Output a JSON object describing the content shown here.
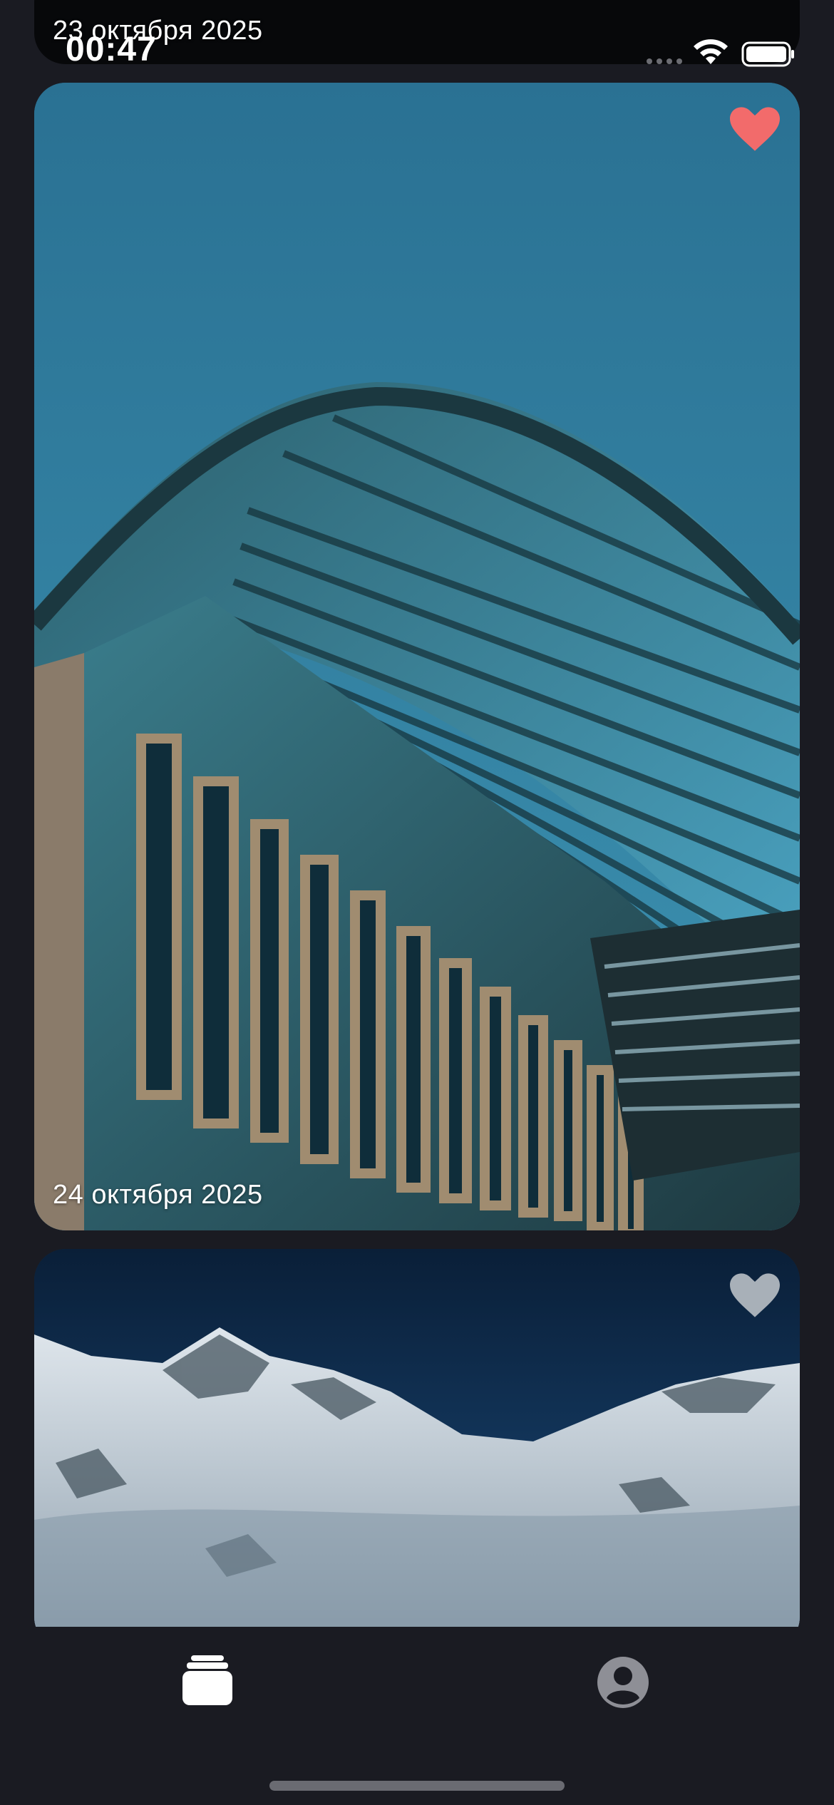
{
  "status_bar": {
    "time": "00:47"
  },
  "feed": {
    "cards": [
      {
        "date": "23 октября 2025",
        "liked": false
      },
      {
        "date": "24 октября 2025",
        "liked": true
      },
      {
        "date": "",
        "liked": false
      }
    ]
  },
  "colors": {
    "background": "#1a1b22",
    "like_active": "#f26b6b",
    "like_inactive": "#a8b0b8",
    "tab_active": "#ffffff",
    "tab_inactive": "#8e8f96"
  },
  "tab_bar": {
    "items": [
      {
        "icon": "stack-icon",
        "active": true
      },
      {
        "icon": "person-circle-icon",
        "active": false
      }
    ]
  }
}
